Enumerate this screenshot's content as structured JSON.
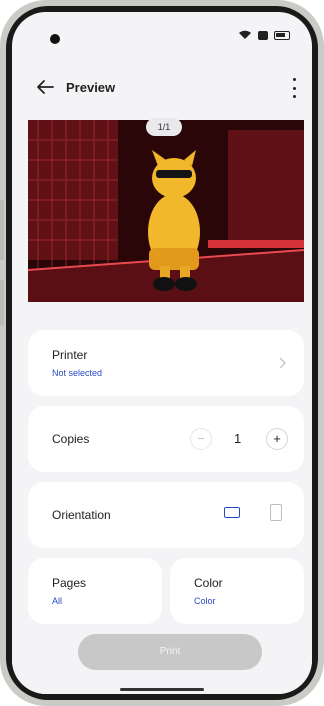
{
  "header": {
    "title": "Preview"
  },
  "preview": {
    "page_indicator": "1/1"
  },
  "printer": {
    "label": "Printer",
    "value": "Not selected"
  },
  "copies": {
    "label": "Copies",
    "value": "1",
    "minus": "−",
    "plus": "+"
  },
  "orientation": {
    "label": "Orientation",
    "selected": "landscape",
    "options": [
      "landscape",
      "portrait"
    ]
  },
  "pages": {
    "label": "Pages",
    "value": "All"
  },
  "color": {
    "label": "Color",
    "value": "Color"
  },
  "actions": {
    "print_label": "Print"
  },
  "colors": {
    "accent": "#2a49c6",
    "print_button": "#c8c8c8",
    "background": "#f4f4f6"
  }
}
